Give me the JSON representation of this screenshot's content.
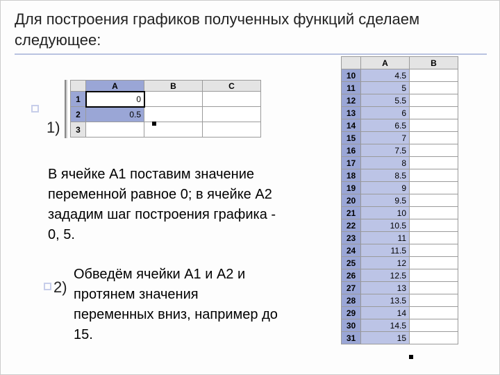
{
  "heading": "Для построения графиков полученных функций сделаем следующее:",
  "step1_label": "1)",
  "step2_label": "2)",
  "para1": "В ячейке А1 поставим значение переменной равное 0; в ячейке А2 зададим шаг построения графика - 0, 5.",
  "para2": "Обведём ячейки А1 и А2 и протянем значения переменных вниз, например до 15.",
  "small_table": {
    "cols": [
      "A",
      "B",
      "C"
    ],
    "rows": [
      "1",
      "2",
      "3"
    ],
    "values": {
      "A1": "0",
      "A2": "0.5"
    }
  },
  "big_table": {
    "cols": [
      "A",
      "B"
    ],
    "rows": [
      "10",
      "11",
      "12",
      "13",
      "14",
      "15",
      "16",
      "17",
      "18",
      "19",
      "20",
      "21",
      "22",
      "23",
      "24",
      "25",
      "26",
      "27",
      "28",
      "29",
      "30",
      "31"
    ],
    "A": [
      "4.5",
      "5",
      "5.5",
      "6",
      "6.5",
      "7",
      "7.5",
      "8",
      "8.5",
      "9",
      "9.5",
      "10",
      "10.5",
      "11",
      "11.5",
      "12",
      "12.5",
      "13",
      "13.5",
      "14",
      "14.5",
      "15"
    ]
  }
}
